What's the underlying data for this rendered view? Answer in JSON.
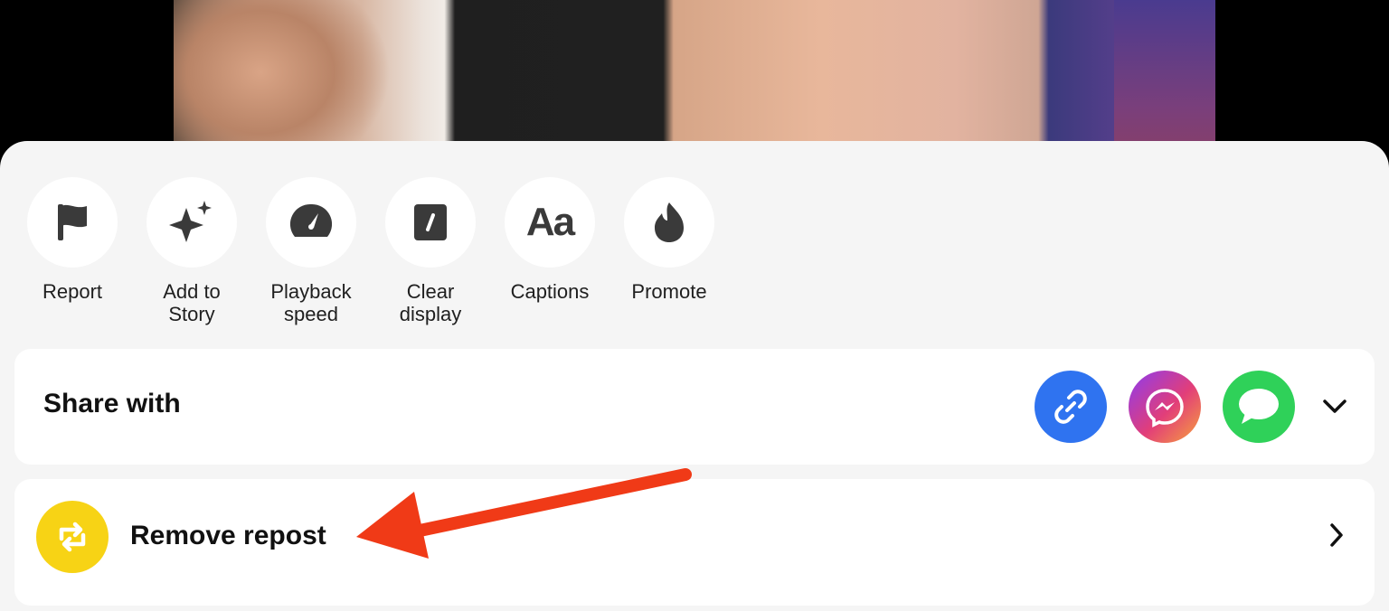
{
  "actions": [
    {
      "label": "Report",
      "icon": "flag-icon"
    },
    {
      "label": "Add to\nStory",
      "icon": "sparkle-icon"
    },
    {
      "label": "Playback\nspeed",
      "icon": "speedometer-icon"
    },
    {
      "label": "Clear\ndisplay",
      "icon": "clear-display-icon"
    },
    {
      "label": "Captions",
      "icon": "captions-icon",
      "glyph": "Aa"
    },
    {
      "label": "Promote",
      "icon": "flame-icon"
    }
  ],
  "share": {
    "title": "Share with",
    "targets": [
      {
        "icon": "copy-link-icon",
        "color": "#2f73f0"
      },
      {
        "icon": "messenger-icon",
        "color": "#e4405f"
      },
      {
        "icon": "messages-icon",
        "color": "#2fd159"
      }
    ]
  },
  "repost": {
    "label": "Remove repost",
    "icon": "repost-icon",
    "color": "#f7d315"
  },
  "annotation": {
    "color": "#f03a17"
  }
}
